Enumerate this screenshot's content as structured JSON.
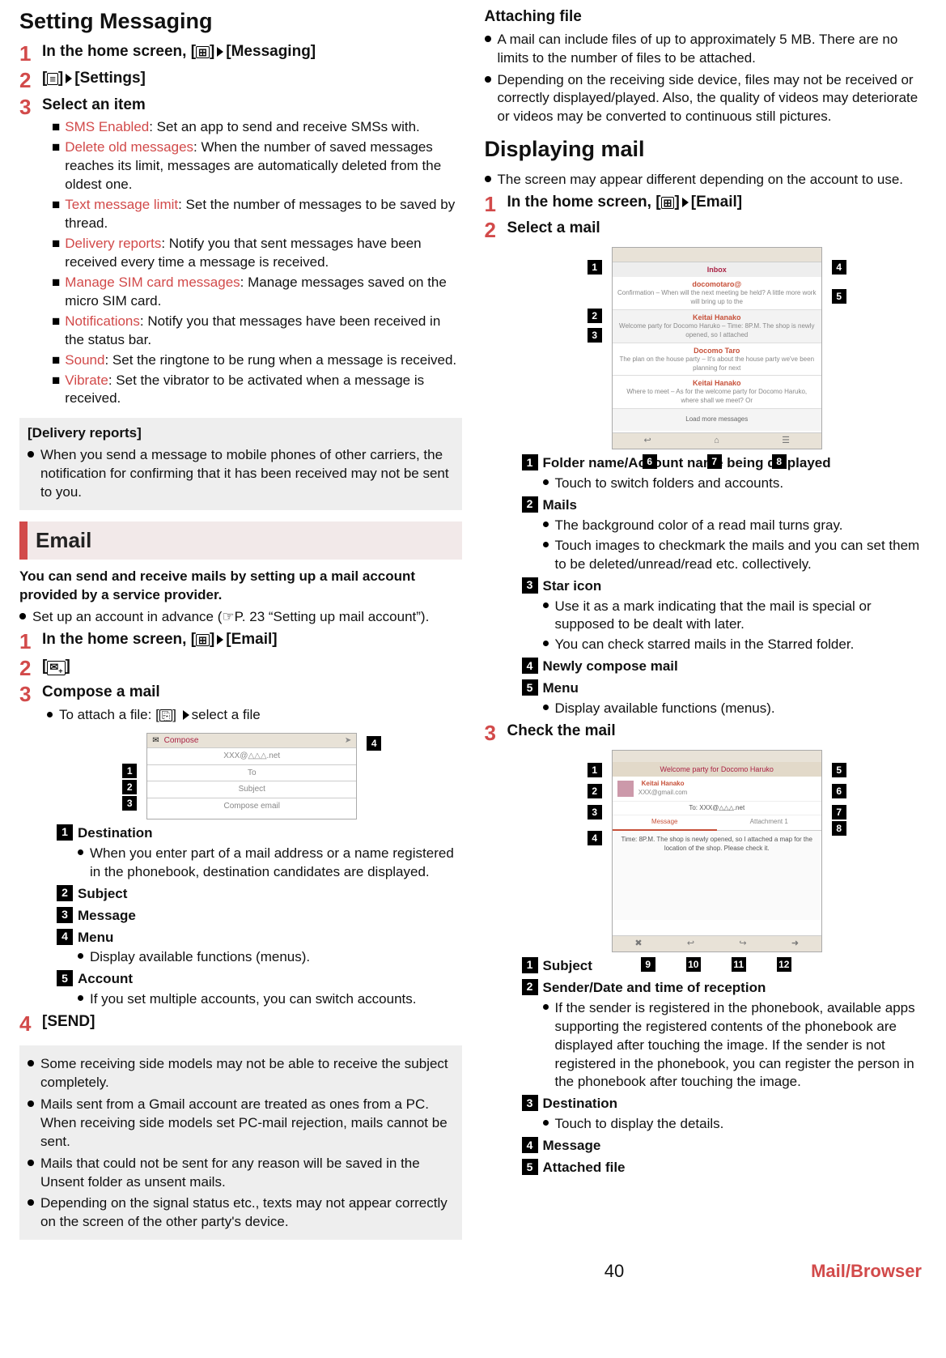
{
  "page_number": "40",
  "section_footer": "Mail/Browser",
  "left": {
    "heading_setting": "Setting Messaging",
    "steps": [
      {
        "title_pre": "In the home screen, [",
        "title_mid": "]",
        "title_post": "[Messaging]"
      },
      {
        "title_pre": "[",
        "title_mid": "]",
        "title_post": "[Settings]"
      },
      {
        "title": "Select an item"
      }
    ],
    "options": [
      {
        "term": "SMS Enabled",
        "desc": ": Set an app to send and receive SMSs with."
      },
      {
        "term": "Delete old messages",
        "desc": ": When the number of saved messages reaches its limit, messages are automatically deleted from the oldest one."
      },
      {
        "term": "Text message limit",
        "desc": ": Set the number of messages to be saved by thread."
      },
      {
        "term": "Delivery reports",
        "desc": ": Notify you that sent messages have been received every time a message is received."
      },
      {
        "term": "Manage SIM card messages",
        "desc": ": Manage messages saved on the micro SIM card."
      },
      {
        "term": "Notifications",
        "desc": ": Notify you that messages have been received in the status bar."
      },
      {
        "term": "Sound",
        "desc": ": Set the ringtone to be rung when a message is received."
      },
      {
        "term": "Vibrate",
        "desc": ": Set the vibrator to be activated when a message is received."
      }
    ],
    "delivery_note_head": "[Delivery reports]",
    "delivery_note_body": "When you send a message to mobile phones of other carriers, the notification for confirming that it has been received may not be sent to you.",
    "email_heading": "Email",
    "email_intro": "You can send and receive mails by setting up a mail account provided by a service provider.",
    "email_setup_note_pre": "Set up an account in advance (",
    "email_setup_note_post": "P. 23 “Setting up mail account”).",
    "email_steps": [
      {
        "title_pre": "In the home screen, [",
        "title_mid": "]",
        "title_post": "[Email]"
      },
      {
        "title_pre": "[",
        "title_mid": "]"
      },
      {
        "title": "Compose a mail",
        "note_pre": "To attach a file: [",
        "note_post": "] ",
        "note_post2": "select a file"
      }
    ],
    "compose_fig": {
      "from": "XXX@△△△.net",
      "subject_ph": "Subject",
      "body_ph": "Compose email",
      "title": "Compose"
    },
    "compose_labels": [
      {
        "n": "1",
        "t": "Destination",
        "sub": [
          "When you enter part of a mail address or a name registered in the phonebook, destination candidates are displayed."
        ]
      },
      {
        "n": "2",
        "t": "Subject"
      },
      {
        "n": "3",
        "t": "Message"
      },
      {
        "n": "4",
        "t": "Menu",
        "sub": [
          "Display available functions (menus)."
        ]
      },
      {
        "n": "5",
        "t": "Account",
        "sub": [
          "If you set multiple accounts, you can switch accounts."
        ]
      }
    ],
    "send_step": "[SEND]",
    "send_notes": [
      "Some receiving side models may not be able to receive the subject completely.",
      "Mails sent from a Gmail account are treated as ones from a PC. When receiving side models set PC-mail rejection, mails cannot be sent.",
      "Mails that could not be sent for any reason will be saved in the Unsent folder as unsent mails.",
      "Depending on the signal status etc., texts may not appear correctly on the screen of the other party's device."
    ]
  },
  "right": {
    "attach_head": "Attaching file",
    "attach_notes": [
      "A mail can include files of up to approximately 5 MB. There are no limits to the number of files to be attached.",
      "Depending on the receiving side device, files may not be received or correctly displayed/played. Also, the quality of videos may deteriorate or videos may be converted to continuous still pictures."
    ],
    "displaying_head": "Displaying mail",
    "displaying_note": "The screen may appear different depending on the account to use.",
    "disp_steps": [
      {
        "title_pre": "In the home screen, [",
        "title_mid": "]",
        "title_post": "[Email]"
      },
      {
        "title": "Select a mail"
      }
    ],
    "inbox_fig": {
      "folder": "Inbox",
      "loadmore": "Load more messages",
      "msgs": [
        {
          "from": "docomotaro@",
          "snip": "Confirmation – When will the next meeting be held? A little more work will bring up to the"
        },
        {
          "from": "Keitai Hanako",
          "snip": "Welcome party for Docomo Haruko – Time: 8P.M. The shop is newly opened, so I attached"
        },
        {
          "from": "Docomo Taro",
          "snip": "The plan on the house party – It's about the house party we've been planning for next"
        },
        {
          "from": "Keitai Hanako",
          "snip": "Where to meet – As for the welcome party for Docomo Haruko, where shall we meet? Or"
        }
      ]
    },
    "inbox_labels": [
      {
        "n": "1",
        "t": "Folder name/Account name being displayed",
        "sub": [
          "Touch to switch folders and accounts."
        ]
      },
      {
        "n": "2",
        "t": "Mails",
        "sub": [
          "The background color of a read mail turns gray.",
          "Touch images to checkmark the mails and you can set them to be deleted/unread/read etc. collectively."
        ]
      },
      {
        "n": "3",
        "t": "Star icon",
        "sub": [
          "Use it as a mark indicating that the mail is special or supposed to be dealt with later.",
          "You can check starred mails in the Starred folder."
        ]
      },
      {
        "n": "4",
        "t": "Newly compose mail"
      },
      {
        "n": "5",
        "t": "Menu",
        "sub": [
          "Display available functions (menus)."
        ]
      }
    ],
    "check_step": "Check the mail",
    "detail_fig": {
      "subject": "Welcome party for Docomo Haruko",
      "sender": "Keitai Hanako",
      "senderaddr": "XXX@gmail.com",
      "to": "XXX@△△△.net",
      "tab_msg": "Message",
      "tab_att": "Attachment 1",
      "body": "Time: 8P.M.\nThe shop is newly opened, so I attached a map for the location of the shop.\nPlease check it."
    },
    "detail_labels": [
      {
        "n": "1",
        "t": "Subject"
      },
      {
        "n": "2",
        "t": "Sender/Date and time of reception",
        "sub": [
          "If the sender is registered in the phonebook, available apps supporting the registered contents of the phonebook are displayed after touching the image. If the sender is not registered in the phonebook, you can register the person in the phonebook after touching the image."
        ]
      },
      {
        "n": "3",
        "t": "Destination",
        "sub": [
          "Touch to display the details."
        ]
      },
      {
        "n": "4",
        "t": "Message"
      },
      {
        "n": "5",
        "t": "Attached file"
      }
    ]
  }
}
